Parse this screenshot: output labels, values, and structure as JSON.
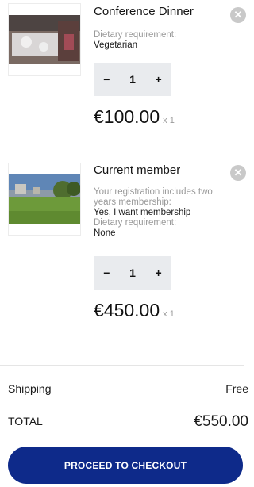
{
  "cart": {
    "items": [
      {
        "title": "Conference Dinner",
        "details": [
          {
            "label": "Dietary requirement:",
            "value": "Vegetarian"
          }
        ],
        "quantity": "1",
        "minus": "−",
        "plus": "+",
        "price": "€100.00",
        "multiplier": "x 1",
        "remove_icon": "close-icon"
      },
      {
        "title": "Current member",
        "details": [
          {
            "label": "Your registration includes two years membership:",
            "value": "Yes, I want membership"
          },
          {
            "label": "Dietary requirement:",
            "value": "None"
          }
        ],
        "quantity": "1",
        "minus": "−",
        "plus": "+",
        "price": "€450.00",
        "multiplier": "x 1",
        "remove_icon": "close-icon"
      }
    ]
  },
  "summary": {
    "shipping_label": "Shipping",
    "shipping_value": "Free",
    "total_label": "TOTAL",
    "total_value": "€550.00"
  },
  "checkout_label": "PROCEED TO CHECKOUT",
  "colors": {
    "accent": "#0e2a8a",
    "qty_bg": "#e9ebee",
    "muted": "#9a9a9a"
  }
}
